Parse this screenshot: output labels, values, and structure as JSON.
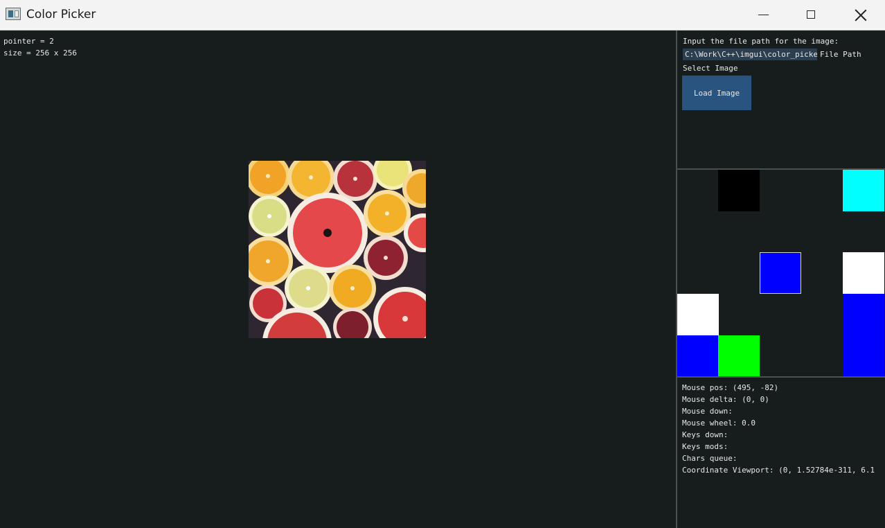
{
  "window": {
    "title": "Color Picker"
  },
  "main": {
    "pointer_text": "pointer = 2",
    "size_text": "size = 256 x 256"
  },
  "image": {
    "subject": "citrus fruit slices"
  },
  "panel": {
    "path_prompt": "Input the file path for the image:",
    "path_value": "C:\\Work\\C++\\imgui\\color_picker",
    "path_label": "File Path",
    "select_label": "Select Image",
    "load_button": "Load Image"
  },
  "swatches": [
    {
      "name": "black",
      "color": "#000000"
    },
    {
      "name": "cyan",
      "color": "#00ffff"
    },
    {
      "name": "blue",
      "color": "#0000ff",
      "selected": true
    },
    {
      "name": "white",
      "color": "#ffffff"
    },
    {
      "name": "white",
      "color": "#ffffff"
    },
    {
      "name": "blue",
      "color": "#0000ff"
    },
    {
      "name": "blue",
      "color": "#0000ff"
    },
    {
      "name": "green",
      "color": "#00ff00"
    },
    {
      "name": "blue",
      "color": "#0000ff"
    }
  ],
  "debug": {
    "mouse_pos": "Mouse pos: (495, -82)",
    "mouse_delta": "Mouse delta: (0, 0)",
    "mouse_down": "Mouse down:",
    "mouse_wheel": "Mouse wheel: 0.0",
    "keys_down": "Keys down:",
    "keys_mods": "Keys mods:",
    "chars_queue": "Chars queue:",
    "coord_viewport": "Coordinate Viewport: (0, 1.52784e-311, 6.1"
  }
}
